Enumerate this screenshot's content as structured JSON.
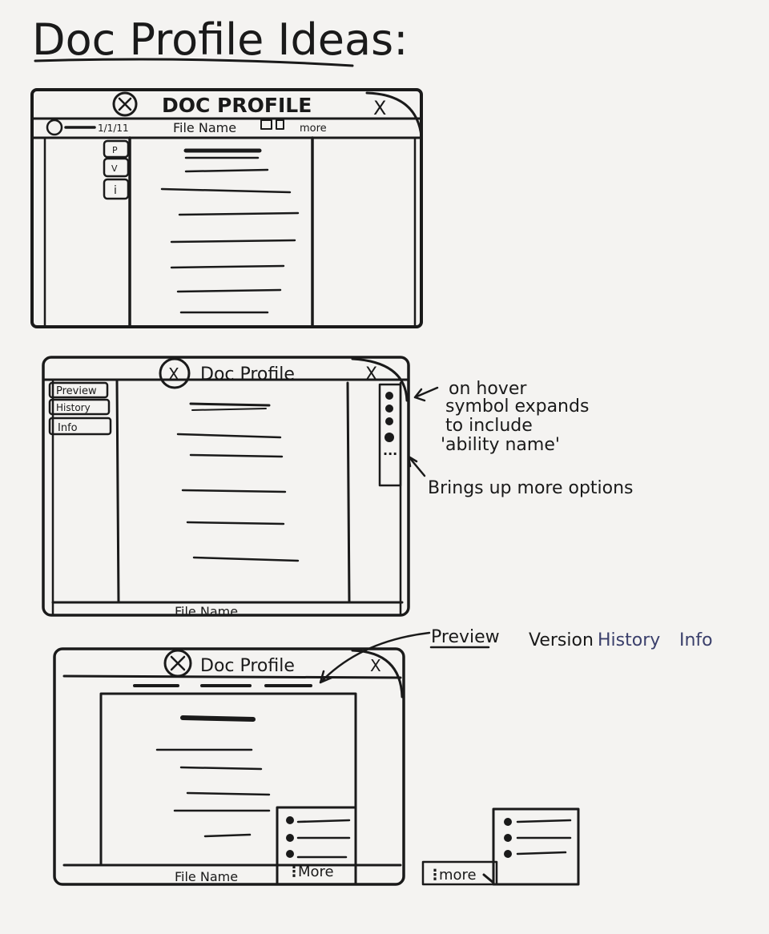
{
  "title": "Doc Profile Ideas:",
  "sketch1": {
    "window_title": "DOC PROFILE",
    "close": "X",
    "date": "1/1/11",
    "file_name": "File Name",
    "more": "more",
    "tabs": [
      "P",
      "V",
      "i"
    ]
  },
  "sketch2": {
    "window_title": "Doc Profile",
    "close": "X",
    "tabs": [
      "Preview",
      "History",
      "Info"
    ],
    "footer": "File Name",
    "dots": "...",
    "note_hover": [
      "on hover",
      "symbol expands",
      "to include",
      "'ability name'"
    ],
    "note_more": "Brings up more options"
  },
  "sketch3": {
    "window_title": "Doc Profile",
    "close": "X",
    "footer": "File Name",
    "more": "More",
    "menu_more": "more",
    "tab_labels": {
      "preview": "Preview",
      "version_history_a": "Version",
      "version_history_b": "History",
      "info": "Info"
    }
  },
  "colors": {
    "ink": "#1a1a1a",
    "blue_marker": "#3a3f6b",
    "board": "#f4f3f1"
  }
}
